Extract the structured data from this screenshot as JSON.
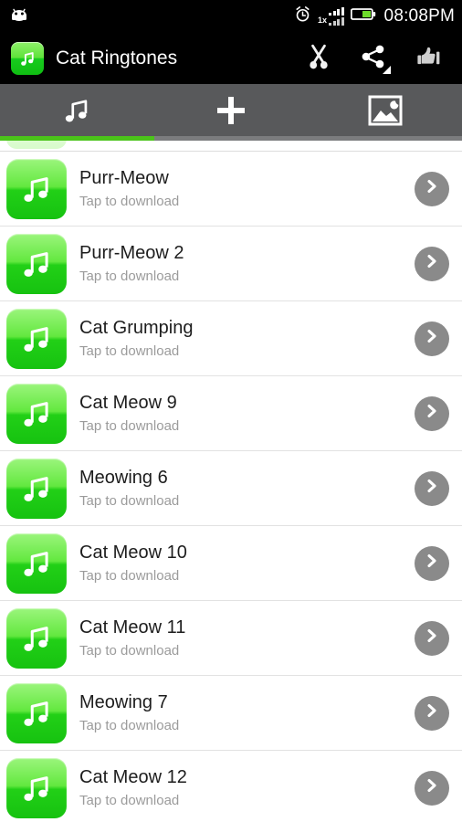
{
  "statusbar": {
    "robot_icon": "android-robot-icon",
    "alarm_icon": "alarm-clock-icon",
    "signal_label": "1x",
    "signal_icon": "signal-bars-icon",
    "battery_icon": "battery-icon",
    "time": "08:08PM"
  },
  "actionbar": {
    "app_icon": "music-note-app-icon",
    "title": "Cat Ringtones",
    "actions": [
      {
        "name": "trim-button",
        "icon": "scissors-icon"
      },
      {
        "name": "share-button",
        "icon": "share-icon"
      },
      {
        "name": "rate-button",
        "icon": "thumbs-up-icon"
      }
    ]
  },
  "tabs": [
    {
      "name": "tab-ringtones",
      "icon": "music-note-icon",
      "active": true
    },
    {
      "name": "tab-add",
      "icon": "plus-icon",
      "active": false
    },
    {
      "name": "tab-wallpapers",
      "icon": "image-icon",
      "active": false
    }
  ],
  "colors": {
    "accent_green": "#4bc41a",
    "icon_green_light": "#9bf57c",
    "icon_green_dark": "#16c210",
    "tabbar_gray": "#58595b",
    "chevron_gray": "#8a8a8a",
    "title_text": "#1d1d1d",
    "subtitle_text": "#9b9b9b",
    "divider": "#e2e2e2",
    "statusbar_bg": "#000000"
  },
  "list": {
    "subtitle": "Tap to download",
    "items": [
      {
        "title": "Purr-Meow",
        "subtitle": "Tap to download"
      },
      {
        "title": "Purr-Meow 2",
        "subtitle": "Tap to download"
      },
      {
        "title": "Cat Grumping",
        "subtitle": "Tap to download"
      },
      {
        "title": "Cat Meow 9",
        "subtitle": "Tap to download"
      },
      {
        "title": "Meowing 6",
        "subtitle": "Tap to download"
      },
      {
        "title": "Cat Meow 10",
        "subtitle": "Tap to download"
      },
      {
        "title": "Cat Meow 11",
        "subtitle": "Tap to download"
      },
      {
        "title": "Meowing 7",
        "subtitle": "Tap to download"
      },
      {
        "title": "Cat Meow 12",
        "subtitle": "Tap to download"
      }
    ]
  }
}
